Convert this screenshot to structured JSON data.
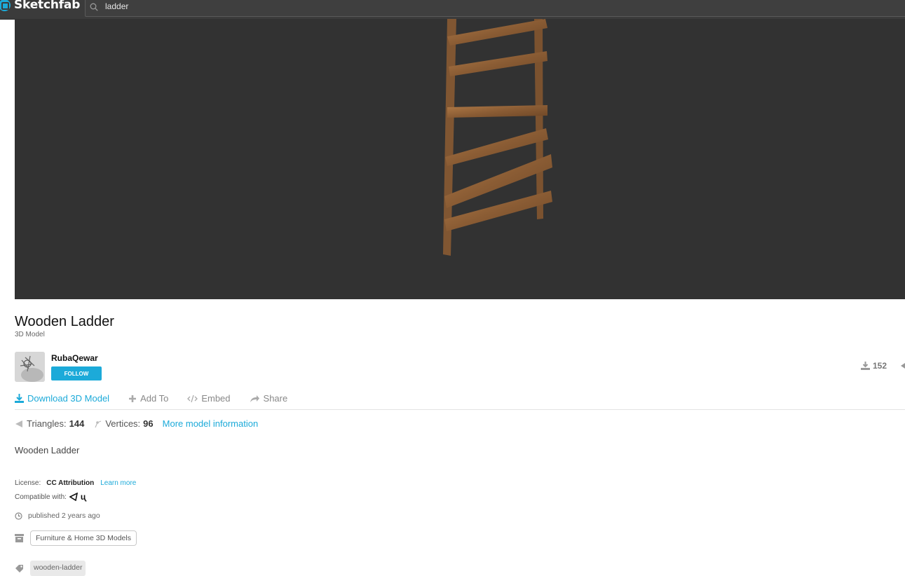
{
  "brand": {
    "logo_text": "Sketchfab"
  },
  "search": {
    "value": "ladder"
  },
  "model": {
    "title": "Wooden Ladder",
    "subtitle": "3D Model",
    "description": "Wooden Ladder"
  },
  "author": {
    "name": "RubaQewar",
    "follow_label": "FOLLOW"
  },
  "stats": {
    "downloads": "152"
  },
  "actions": {
    "download": "Download 3D Model",
    "add_to": "Add To",
    "embed": "Embed",
    "share": "Share"
  },
  "metrics": {
    "triangles_label": "Triangles:",
    "triangles": "144",
    "vertices_label": "Vertices:",
    "vertices": "96",
    "more_info": "More model information"
  },
  "license": {
    "label": "License:",
    "name": "CC Attribution",
    "learn_more": "Learn more",
    "compatible_label": "Compatible with:"
  },
  "published": "published 2 years ago",
  "category": "Furniture & Home 3D Models",
  "tag": "wooden-ladder",
  "colors": {
    "accent": "#1caad9",
    "viewer_bg": "#323232",
    "topbar_bg": "#3b3b3b",
    "wood": "#9a6a40"
  },
  "icons": {
    "brand": "sketchfab-logo-icon",
    "search": "search-icon",
    "download_count": "download-icon",
    "download_action": "download-icon",
    "add": "plus-icon",
    "embed": "code-icon",
    "share": "share-arrow-icon",
    "triangles": "triangle-icon",
    "vertices": "vertex-icon",
    "unity": "unity-icon",
    "unreal": "unreal-icon",
    "clock": "clock-icon",
    "category": "archive-icon",
    "tag": "tag-icon"
  }
}
